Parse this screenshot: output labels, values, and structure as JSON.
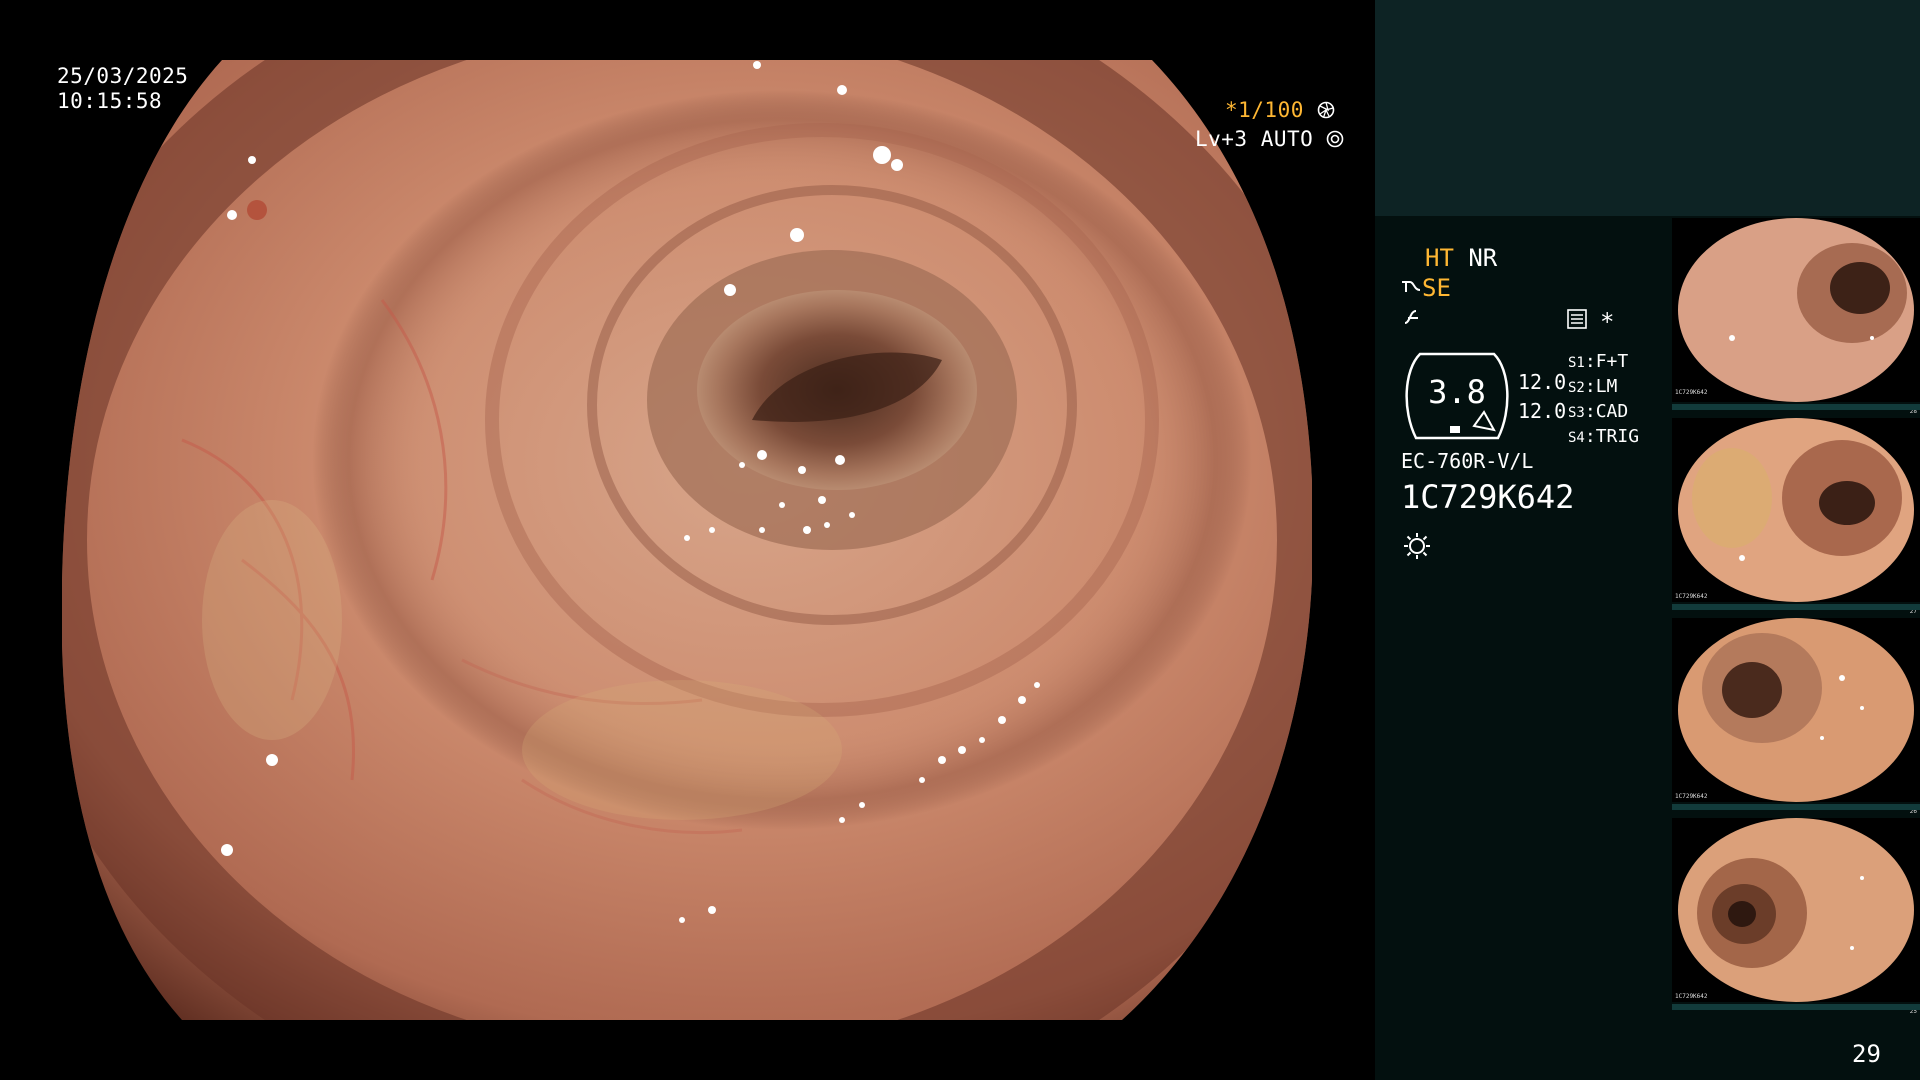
{
  "overlay": {
    "date": "25/03/2025",
    "time": "10:15:58",
    "shutter": "*1/100",
    "level": "Lv+3 AUTO"
  },
  "panel": {
    "ht_label": "HT",
    "nr_label": "NR",
    "se_label": "SE",
    "magnification_value": "3.8",
    "value_a": "12.0",
    "value_b": "12.0",
    "asterisk": "*",
    "switches": [
      {
        "key": "S1",
        "value": "F+T"
      },
      {
        "key": "S2",
        "value": "LM"
      },
      {
        "key": "S3",
        "value": "CAD"
      },
      {
        "key": "S4",
        "value": "TRIG"
      }
    ],
    "scope_model": "EC-760R-V/L",
    "serial": "1C729K642",
    "page_number": "29"
  },
  "thumbnails": [
    {
      "serial": "1C729K642",
      "index": "28"
    },
    {
      "serial": "1C729K642",
      "index": "27"
    },
    {
      "serial": "1C729K642",
      "index": "26"
    },
    {
      "serial": "1C729K642",
      "index": "25"
    }
  ],
  "icons": {
    "shutter": "aperture-icon",
    "auto": "iris-icon",
    "structure": "structure-enhance-icon",
    "color": "color-enhance-icon",
    "menu": "settings-panel-icon",
    "light": "light-source-icon"
  },
  "colors": {
    "accent": "#ffb733",
    "panel": "#03100f",
    "panel_top": "#0d2324",
    "thumb_bar": "#123b3b"
  }
}
